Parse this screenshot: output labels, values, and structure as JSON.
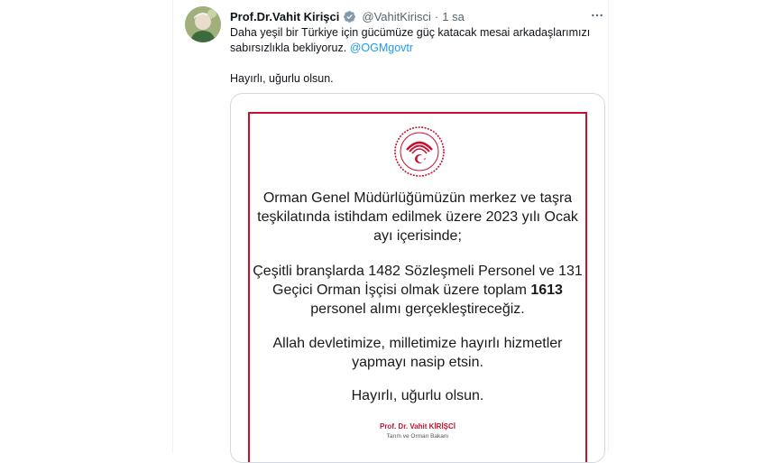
{
  "tweet": {
    "author_name": "Prof.Dr.Vahit Kirişci",
    "handle": "@VahitKirisci",
    "separator": "·",
    "time": "1 sa",
    "text_main": "Daha yeşil bir Türkiye için gücümüze güç katacak mesai arkadaşlarımızı sabırsızlıkla bekliyoruz.",
    "mention": "@OGMgovtr",
    "text_line2": "Hayırlı, uğurlu olsun."
  },
  "announcement": {
    "para1": "Orman Genel Müdürlüğümüzün merkez ve taşra teşkilatında istihdam edilmek üzere 2023 yılı Ocak ayı içerisinde;",
    "para2": "Çeşitli branşlarda 1482 Sözleşmeli Personel ve 131 Geçici Orman İşçisi olmak üzere toplam",
    "para2_bold": "1613",
    "para2_tail": "personel alımı gerçekleştireceğiz.",
    "para3": "Allah devletimize, milletimize hayırlı hizmetler yapmayı nasip etsin.",
    "para4": "Hayırlı, uğurlu olsun.",
    "signature_prefix": "Prof. Dr. Vahit ",
    "signature_surname": "KİRİŞCİ",
    "signature_title": "Tarım ve Orman Bakanı"
  },
  "colors": {
    "accent_blue": "#1d9bf0",
    "brand_red": "#c8102e",
    "text_primary": "#0f1419",
    "text_secondary": "#536471"
  },
  "icons": {
    "verified": "verified-badge-icon",
    "more": "more-options-icon",
    "emblem": "ministry-emblem-icon"
  }
}
